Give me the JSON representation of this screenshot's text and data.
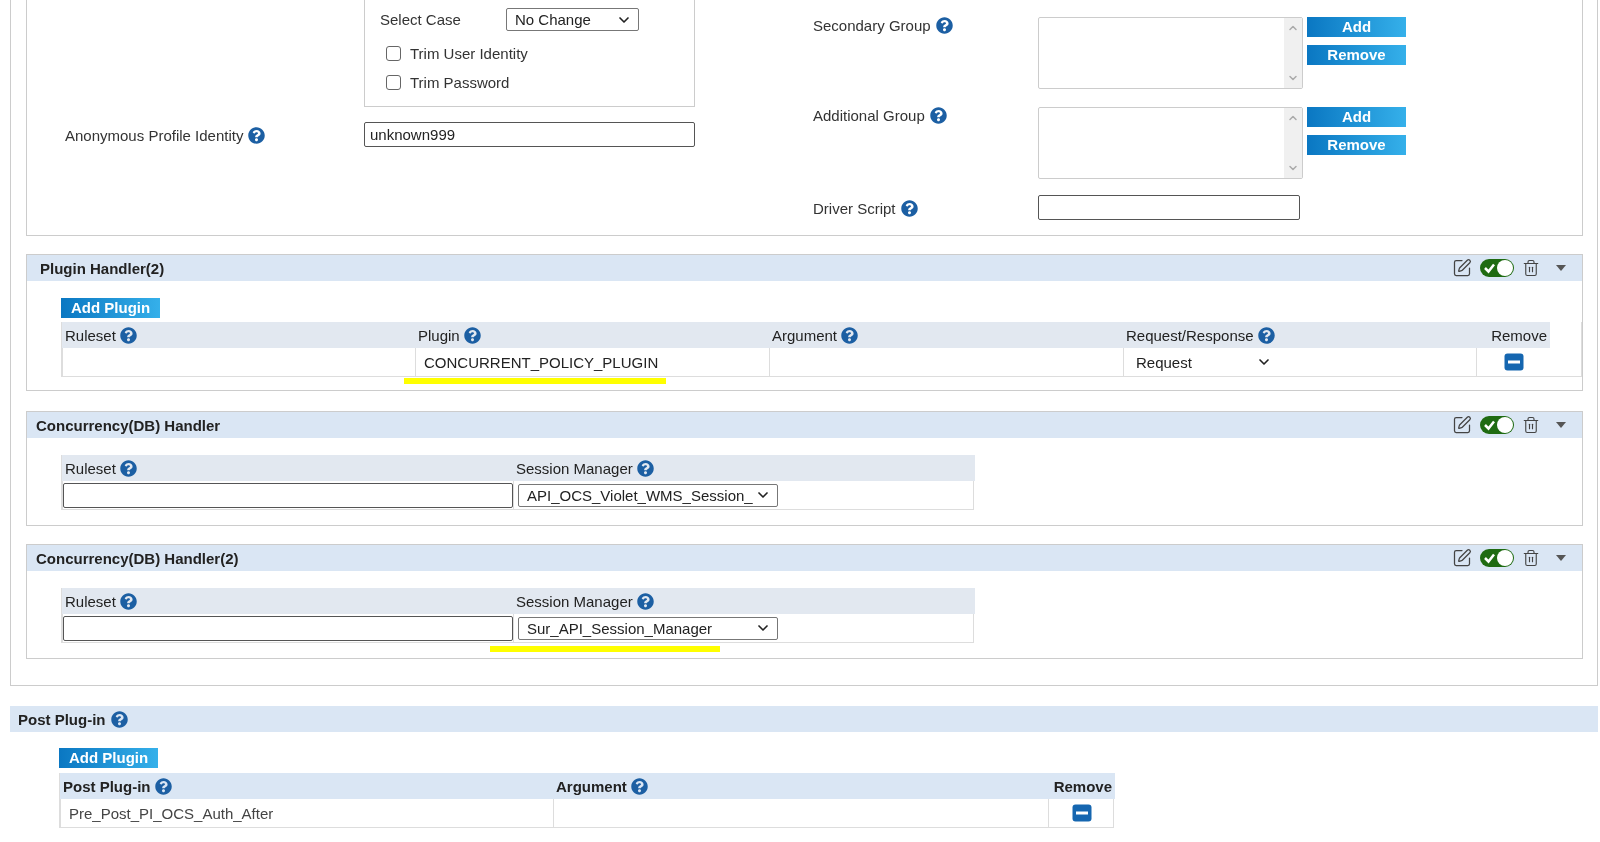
{
  "settings": {
    "select_case": {
      "label": "Select Case",
      "value": "No Change"
    },
    "checkboxes": [
      {
        "label": "Trim User Identity",
        "checked": false
      },
      {
        "label": "Trim Password",
        "checked": false
      }
    ],
    "anonymous_profile": {
      "label": "Anonymous Profile Identity",
      "value": "unknown999"
    },
    "groups": [
      {
        "label": "Secondary Group",
        "buttons": [
          "Add",
          "Remove"
        ]
      },
      {
        "label": "Additional Group",
        "buttons": [
          "Add",
          "Remove"
        ]
      }
    ],
    "driver_script": {
      "label": "Driver Script"
    }
  },
  "handlers": [
    {
      "kind": "plugin",
      "title": "Plugin Handler(2)",
      "enabled": true,
      "add_button": "Add Plugin",
      "columns": [
        {
          "label": "Ruleset",
          "help": true
        },
        {
          "label": "Plugin",
          "help": true
        },
        {
          "label": "Argument",
          "help": true
        },
        {
          "label": "Request/Response",
          "help": true
        },
        {
          "label": "Remove",
          "help": false
        }
      ],
      "rows": [
        {
          "plugin": "CONCURRENT_POLICY_PLUGIN",
          "highlighted": true,
          "request_response": "Request"
        }
      ]
    },
    {
      "kind": "concurrency",
      "title": "Concurrency(DB) Handler",
      "enabled": true,
      "columns": [
        {
          "label": "Ruleset",
          "help": true
        },
        {
          "label": "Session Manager",
          "help": true
        }
      ],
      "rows": [
        {
          "session_manager": "API_OCS_Violet_WMS_Session_",
          "highlighted": false
        }
      ]
    },
    {
      "kind": "concurrency",
      "title": "Concurrency(DB) Handler(2)",
      "enabled": true,
      "columns": [
        {
          "label": "Ruleset",
          "help": true
        },
        {
          "label": "Session Manager",
          "help": true
        }
      ],
      "rows": [
        {
          "session_manager": "Sur_API_Session_Manager",
          "highlighted": true
        }
      ]
    }
  ],
  "post_plugin": {
    "title": "Post Plug-in",
    "add_button": "Add Plugin",
    "columns": [
      {
        "label": "Post Plug-in",
        "help": true
      },
      {
        "label": "Argument",
        "help": true
      },
      {
        "label": "Remove",
        "help": false
      }
    ],
    "rows": [
      {
        "post_plugin": "Pre_Post_PI_OCS_Auth_After"
      }
    ]
  }
}
